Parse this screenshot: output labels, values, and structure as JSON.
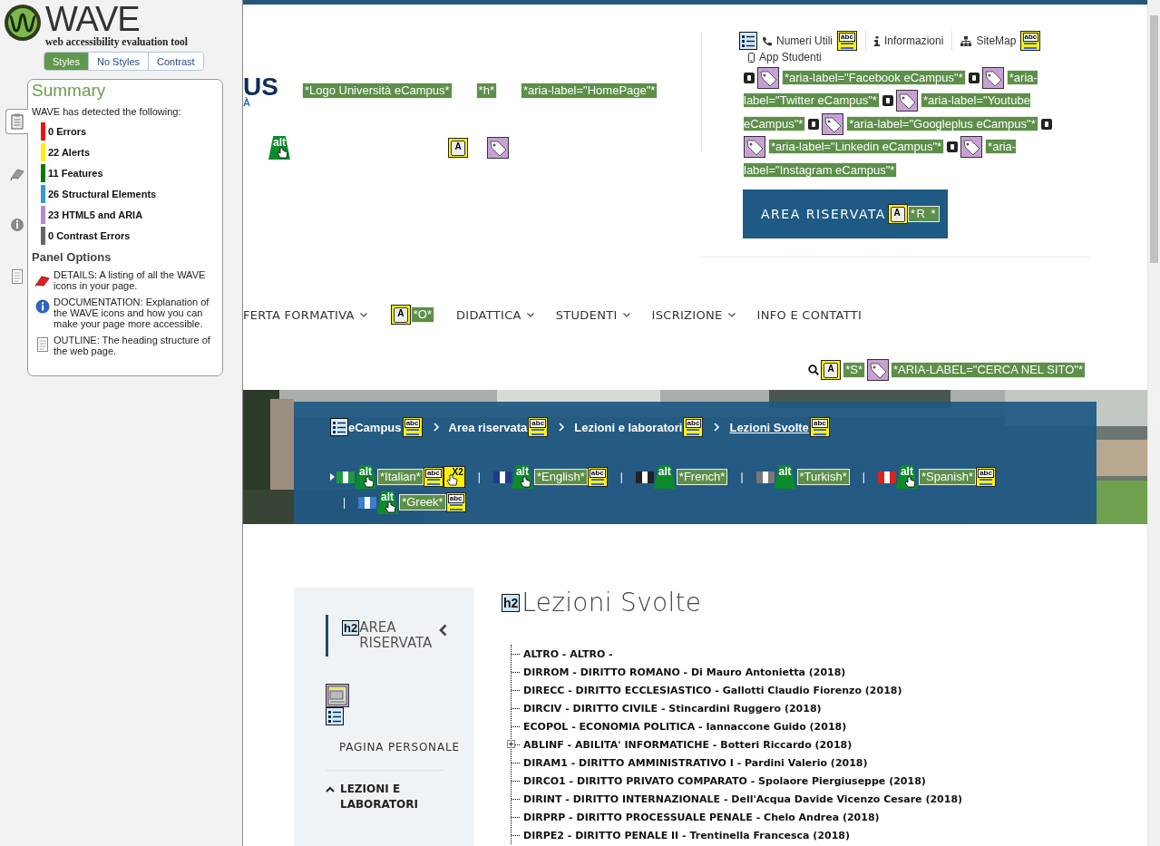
{
  "wave": {
    "title": "WAVE",
    "subtitle": "web accessibility evaluation tool",
    "view_tabs": [
      {
        "label": "Styles",
        "selected": true
      },
      {
        "label": "No Styles",
        "selected": false
      },
      {
        "label": "Contrast",
        "selected": false
      }
    ],
    "side_tabs": [
      {
        "kind": "summary",
        "selected": true
      },
      {
        "kind": "details",
        "selected": false
      },
      {
        "kind": "documentation",
        "selected": false
      },
      {
        "kind": "outline",
        "selected": false
      }
    ],
    "summary": {
      "title": "Summary",
      "intro": "WAVE has detected the following:",
      "counts": [
        {
          "label": "0 Errors",
          "color": "#ee1111"
        },
        {
          "label": "22 Alerts",
          "color": "#ffee00"
        },
        {
          "label": "11 Features",
          "color": "#117711"
        },
        {
          "label": "26 Structural Elements",
          "color": "#3399dd"
        },
        {
          "label": "23 HTML5 and ARIA",
          "color": "#bb88cc"
        },
        {
          "label": "0 Contrast Errors",
          "color": "#666666"
        }
      ]
    },
    "panel_options": {
      "title": "Panel Options",
      "items": [
        {
          "kind": "details",
          "text": "DETAILS: A listing of all the WAVE icons in your page."
        },
        {
          "kind": "documentation",
          "text": "DOCUMENTATION: Explanation of the WAVE icons and how you can make your page more accessible."
        },
        {
          "kind": "outline",
          "text": "OUTLINE: The heading structure of the web page."
        }
      ]
    }
  },
  "header": {
    "logo": [
      "US",
      "À"
    ],
    "marks": [
      [
        {
          "kind": "label",
          "text": "*Logo Università eCampus*"
        },
        {
          "kind": "label",
          "text": "*h*"
        },
        {
          "kind": "label",
          "text": "*aria-label=\"HomePage\"*"
        }
      ],
      [
        {
          "kind": "alt",
          "text": "alt",
          "hand": true
        },
        {
          "kind": "key",
          "text": "A"
        },
        {
          "kind": "tag"
        }
      ]
    ],
    "top_links": [
      {
        "kind": "list"
      },
      {
        "kind": "phone"
      },
      {
        "kind": "link",
        "text": "Numeri Utili"
      },
      {
        "kind": "abc",
        "text": "abc"
      },
      {
        "kind": "vline"
      },
      {
        "kind": "info"
      },
      {
        "kind": "link",
        "text": "Informazioni"
      },
      {
        "kind": "vline"
      },
      {
        "kind": "sitemap"
      },
      {
        "kind": "link",
        "text": "SiteMap"
      },
      {
        "kind": "abc",
        "text": "abc"
      },
      {
        "kind": "mobile"
      },
      {
        "kind": "link",
        "text": "App Studenti"
      }
    ],
    "social": [
      {
        "kind": "social"
      },
      {
        "kind": "tag"
      },
      {
        "kind": "label",
        "text": "*aria-label=\"Facebook eCampus\"*"
      },
      {
        "kind": "social"
      },
      {
        "kind": "tag"
      },
      {
        "kind": "label",
        "text": "*aria-label=\"Twitter eCampus\"*"
      },
      {
        "kind": "social"
      },
      {
        "kind": "tag"
      },
      {
        "kind": "label",
        "text": "*aria-label=\"Youtube eCampus\"*"
      },
      {
        "kind": "social"
      },
      {
        "kind": "tag"
      },
      {
        "kind": "label",
        "text": "*aria-label=\"Googleplus eCampus\"*"
      },
      {
        "kind": "social"
      },
      {
        "kind": "tag"
      },
      {
        "kind": "label",
        "text": "*aria-label=\"Linkedin eCampus\"*"
      },
      {
        "kind": "social"
      },
      {
        "kind": "tag"
      },
      {
        "kind": "label",
        "text": "*aria-label=\"Instagram eCampus\"*"
      }
    ],
    "reserved_button": {
      "label": "AREA RISERVATA",
      "marks": [
        {
          "kind": "key",
          "text": "A"
        },
        {
          "kind": "label",
          "text": "*R *"
        }
      ]
    }
  },
  "nav": {
    "items": [
      {
        "kind": "menu",
        "text": "FERTA FORMATIVA",
        "caret": true
      },
      {
        "kind": "key",
        "text": "A"
      },
      {
        "kind": "label",
        "text": "*O*"
      },
      {
        "kind": "menu",
        "text": "DIDATTICA",
        "caret": true
      },
      {
        "kind": "menu",
        "text": "STUDENTI",
        "caret": true
      },
      {
        "kind": "menu",
        "text": "ISCRIZIONE",
        "caret": true
      },
      {
        "kind": "menu",
        "text": "INFO E CONTATTI",
        "caret": false
      }
    ],
    "search": [
      {
        "kind": "search"
      },
      {
        "kind": "key",
        "text": "A"
      },
      {
        "kind": "label",
        "text": "*S*"
      },
      {
        "kind": "tag"
      },
      {
        "kind": "label",
        "text": "*ARIA-LABEL=\"CERCA NEL SITO\"*"
      }
    ]
  },
  "banner": {
    "breadcrumb": [
      {
        "kind": "list"
      },
      {
        "kind": "crumb",
        "text": "eCampus",
        "current": false
      },
      {
        "kind": "abc",
        "text": "abc"
      },
      {
        "kind": "chevron"
      },
      {
        "kind": "crumb",
        "text": "Area riservata",
        "current": false
      },
      {
        "kind": "abc",
        "text": "abc"
      },
      {
        "kind": "chevron"
      },
      {
        "kind": "crumb",
        "text": "Lezioni e laboratori",
        "current": false
      },
      {
        "kind": "abc",
        "text": "abc"
      },
      {
        "kind": "chevron"
      },
      {
        "kind": "crumb",
        "text": "Lezioni Svolte",
        "current": true
      },
      {
        "kind": "abc",
        "text": "abc"
      }
    ],
    "languages": [
      {
        "kind": "arrow"
      },
      {
        "kind": "flag",
        "color": "#1e9a3e"
      },
      {
        "kind": "alt",
        "text": "alt",
        "hand": true
      },
      {
        "kind": "label",
        "text": "*Italian*"
      },
      {
        "kind": "abc",
        "text": "abc"
      },
      {
        "kind": "x2",
        "text": "X2"
      },
      {
        "kind": "pipe",
        "text": "|"
      },
      {
        "kind": "flag",
        "color": "#1f3c88"
      },
      {
        "kind": "alt",
        "text": "alt",
        "hand": true
      },
      {
        "kind": "label",
        "text": "*English*"
      },
      {
        "kind": "abc",
        "text": "abc"
      },
      {
        "kind": "pipe",
        "text": "|"
      },
      {
        "kind": "flag",
        "color": "#222222"
      },
      {
        "kind": "alt",
        "text": "alt",
        "hand": false
      },
      {
        "kind": "label",
        "text": "*French*"
      },
      {
        "kind": "pipe",
        "text": "|"
      },
      {
        "kind": "flag",
        "color": "#777777"
      },
      {
        "kind": "alt",
        "text": "alt",
        "hand": false
      },
      {
        "kind": "label",
        "text": "*Turkish*"
      },
      {
        "kind": "pipe",
        "text": "|"
      },
      {
        "kind": "flag",
        "color": "#d8231f"
      },
      {
        "kind": "alt",
        "text": "alt",
        "hand": true
      },
      {
        "kind": "label",
        "text": "*Spanish*"
      },
      {
        "kind": "abc",
        "text": "abc"
      },
      {
        "kind": "pipe",
        "text": "|"
      },
      {
        "kind": "flag",
        "color": "#3c7cd0"
      },
      {
        "kind": "alt",
        "text": "alt",
        "hand": true
      },
      {
        "kind": "label",
        "text": "*Greek*"
      },
      {
        "kind": "abc",
        "text": "abc"
      }
    ]
  },
  "sidebar": {
    "heading_marks": [
      {
        "kind": "h2",
        "text": "h2"
      }
    ],
    "heading": "AREA RISERVATA",
    "items": [
      {
        "kind": "page",
        "marks": [
          {
            "kind": "region"
          },
          {
            "kind": "list"
          }
        ],
        "text": "PAGINA PERSONALE"
      },
      {
        "kind": "section",
        "text": "LEZIONI E LABORATORI",
        "expanded": true
      }
    ]
  },
  "content": {
    "heading_marks": [
      {
        "kind": "h2",
        "text": "h2"
      }
    ],
    "title": "Lezioni Svolte",
    "tree": [
      {
        "kind": "leaf",
        "text": "ALTRO - ALTRO -"
      },
      {
        "kind": "leaf",
        "text": "DIRROM - DIRITTO ROMANO - Di Mauro Antonietta (2018)"
      },
      {
        "kind": "leaf",
        "text": "DIRECC - DIRITTO ECCLESIASTICO - Gallotti Claudio Fiorenzo (2018)"
      },
      {
        "kind": "leaf",
        "text": "DIRCIV - DIRITTO CIVILE - Stincardini Ruggero (2018)"
      },
      {
        "kind": "leaf",
        "text": "ECOPOL - ECONOMIA POLITICA - Iannaccone Guido (2018)"
      },
      {
        "kind": "folder",
        "text": "ABLINF - ABILITA' INFORMATICHE - Botteri Riccardo (2018)"
      },
      {
        "kind": "leaf",
        "text": "DIRAM1 - DIRITTO AMMINISTRATIVO I - Pardini Valerio (2018)"
      },
      {
        "kind": "leaf",
        "text": "DIRCO1 - DIRITTO PRIVATO COMPARATO - Spolaore Piergiuseppe (2018)"
      },
      {
        "kind": "leaf",
        "text": "DIRINT - DIRITTO INTERNAZIONALE - Dell'Acqua Davide Vicenzo Cesare (2018)"
      },
      {
        "kind": "leaf",
        "text": "DIRPRP - DIRITTO PROCESSUALE PENALE - Chelo Andrea (2018)"
      },
      {
        "kind": "leaf",
        "text": "DIRPE2 - DIRITTO PENALE II - Trentinella Francesca (2018)"
      }
    ]
  }
}
